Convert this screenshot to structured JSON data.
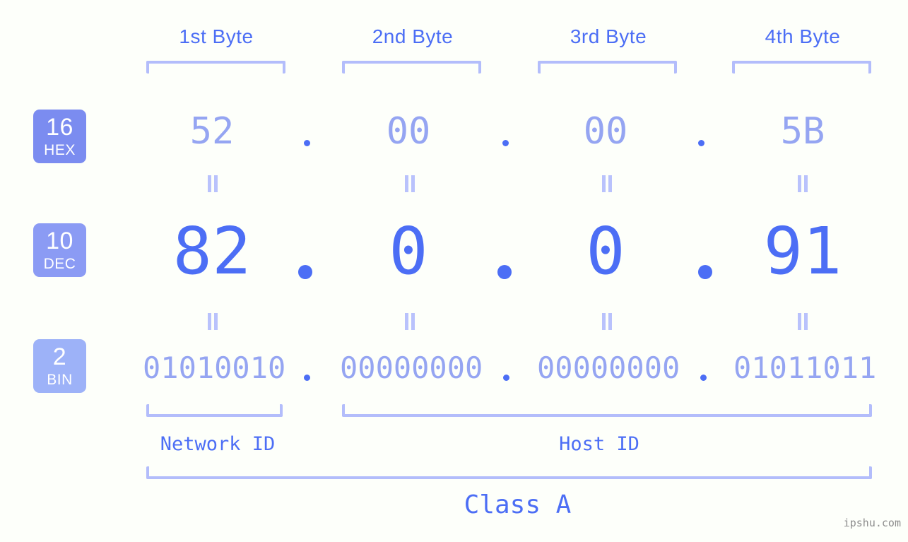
{
  "meta": {
    "background_color": "#fdfffa",
    "accent_color": "#4c6ef5",
    "accent_light_color": "#95a5f2",
    "bracket_color": "#b3bdfb",
    "watermark": "ipshu.com"
  },
  "headers": [
    {
      "label": "1st Byte"
    },
    {
      "label": "2nd Byte"
    },
    {
      "label": "3rd Byte"
    },
    {
      "label": "4th Byte"
    }
  ],
  "rows": [
    {
      "badge": {
        "number": "16",
        "name": "HEX",
        "color": "#7b8cf0"
      },
      "values": [
        "52",
        "00",
        "00",
        "5B"
      ],
      "separator": "."
    },
    {
      "badge": {
        "number": "10",
        "name": "DEC",
        "color": "#8b9bf4"
      },
      "values": [
        "82",
        "0",
        "0",
        "91"
      ],
      "separator": "."
    },
    {
      "badge": {
        "number": "2",
        "name": "BIN",
        "color": "#9db2f8"
      },
      "values": [
        "01010010",
        "00000000",
        "00000000",
        "01011011"
      ],
      "separator": "."
    }
  ],
  "equals_symbol": "=",
  "segments": [
    {
      "label": "Network ID"
    },
    {
      "label": "Host ID"
    }
  ],
  "class": {
    "label": "Class A"
  }
}
